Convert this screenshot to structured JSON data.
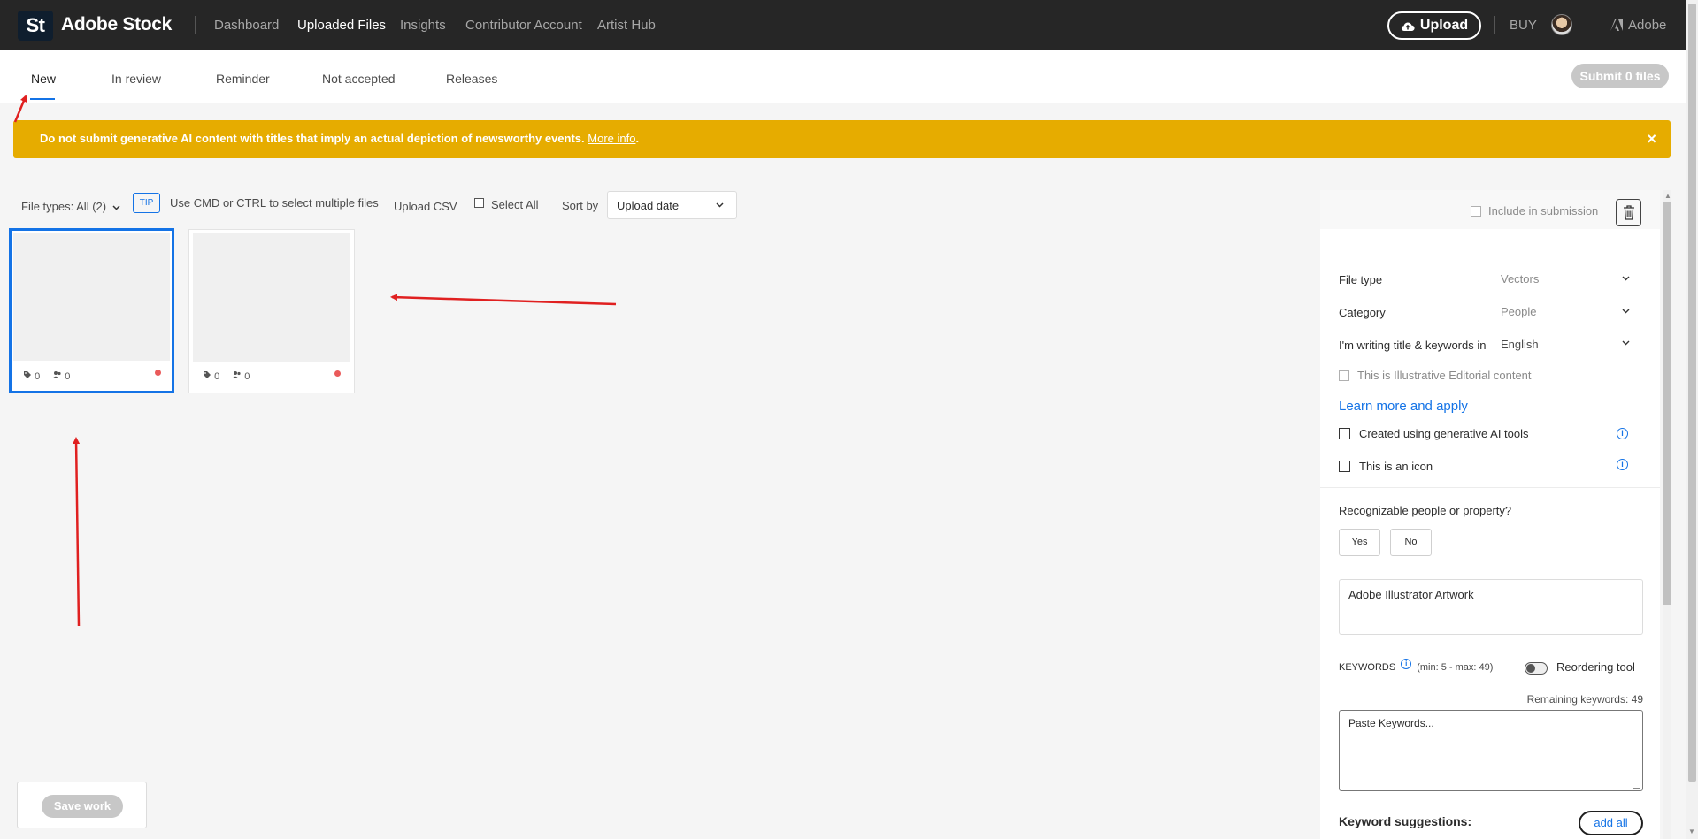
{
  "header": {
    "logo": "St",
    "brand": "Adobe Stock",
    "nav": [
      "Dashboard",
      "Uploaded Files",
      "Insights",
      "Contributor Account",
      "Artist Hub"
    ],
    "active_nav": "Uploaded Files",
    "upload_label": "Upload",
    "buy_label": "BUY",
    "adobe_label": "Adobe"
  },
  "tabs": {
    "items": [
      "New",
      "In review",
      "Reminder",
      "Not accepted",
      "Releases"
    ],
    "active": "New",
    "submit_label": "Submit 0 files"
  },
  "banner": {
    "text": "Do not submit generative AI content with titles that imply an actual depiction of newsworthy events. ",
    "link": "More info",
    "suffix": ".",
    "close": "×",
    "color": "#e6ac00"
  },
  "toolbar": {
    "filetypes": "File types: All (2)",
    "tip_badge": "TIP",
    "tip_text": "Use CMD or CTRL to select multiple files",
    "upload_csv": "Upload CSV",
    "select_all": "Select All",
    "sort_label": "Sort by",
    "sort_value": "Upload date"
  },
  "thumbnails": [
    {
      "keywords": "0",
      "people": "0",
      "selected": true
    },
    {
      "keywords": "0",
      "people": "0",
      "selected": false
    }
  ],
  "save_label": "Save work",
  "panel": {
    "include_label": "Include in submission",
    "file_type_label": "File type",
    "file_type_value": "Vectors",
    "category_label": "Category",
    "category_value": "People",
    "language_label": "I'm writing title & keywords in",
    "language_value": "English",
    "editorial_label": "This is Illustrative Editorial content",
    "learn_more": "Learn more and apply",
    "gen_ai_label": "Created using generative AI tools",
    "icon_label": "This is an icon",
    "recognizable_label": "Recognizable people or property?",
    "yes_label": "Yes",
    "no_label": "No",
    "title_value": "Adobe Illustrator Artwork",
    "keywords_label": "KEYWORDS",
    "keywords_range": "(min: 5 - max: 49)",
    "reorder_label": "Reordering tool",
    "remaining_label": "Remaining keywords: 49",
    "keywords_placeholder": "Paste Keywords...",
    "suggestions_label": "Keyword suggestions:",
    "add_all_label": "add all"
  },
  "colors": {
    "accent": "#1473e6",
    "topbar": "#262626",
    "annotation": "#e02020"
  }
}
